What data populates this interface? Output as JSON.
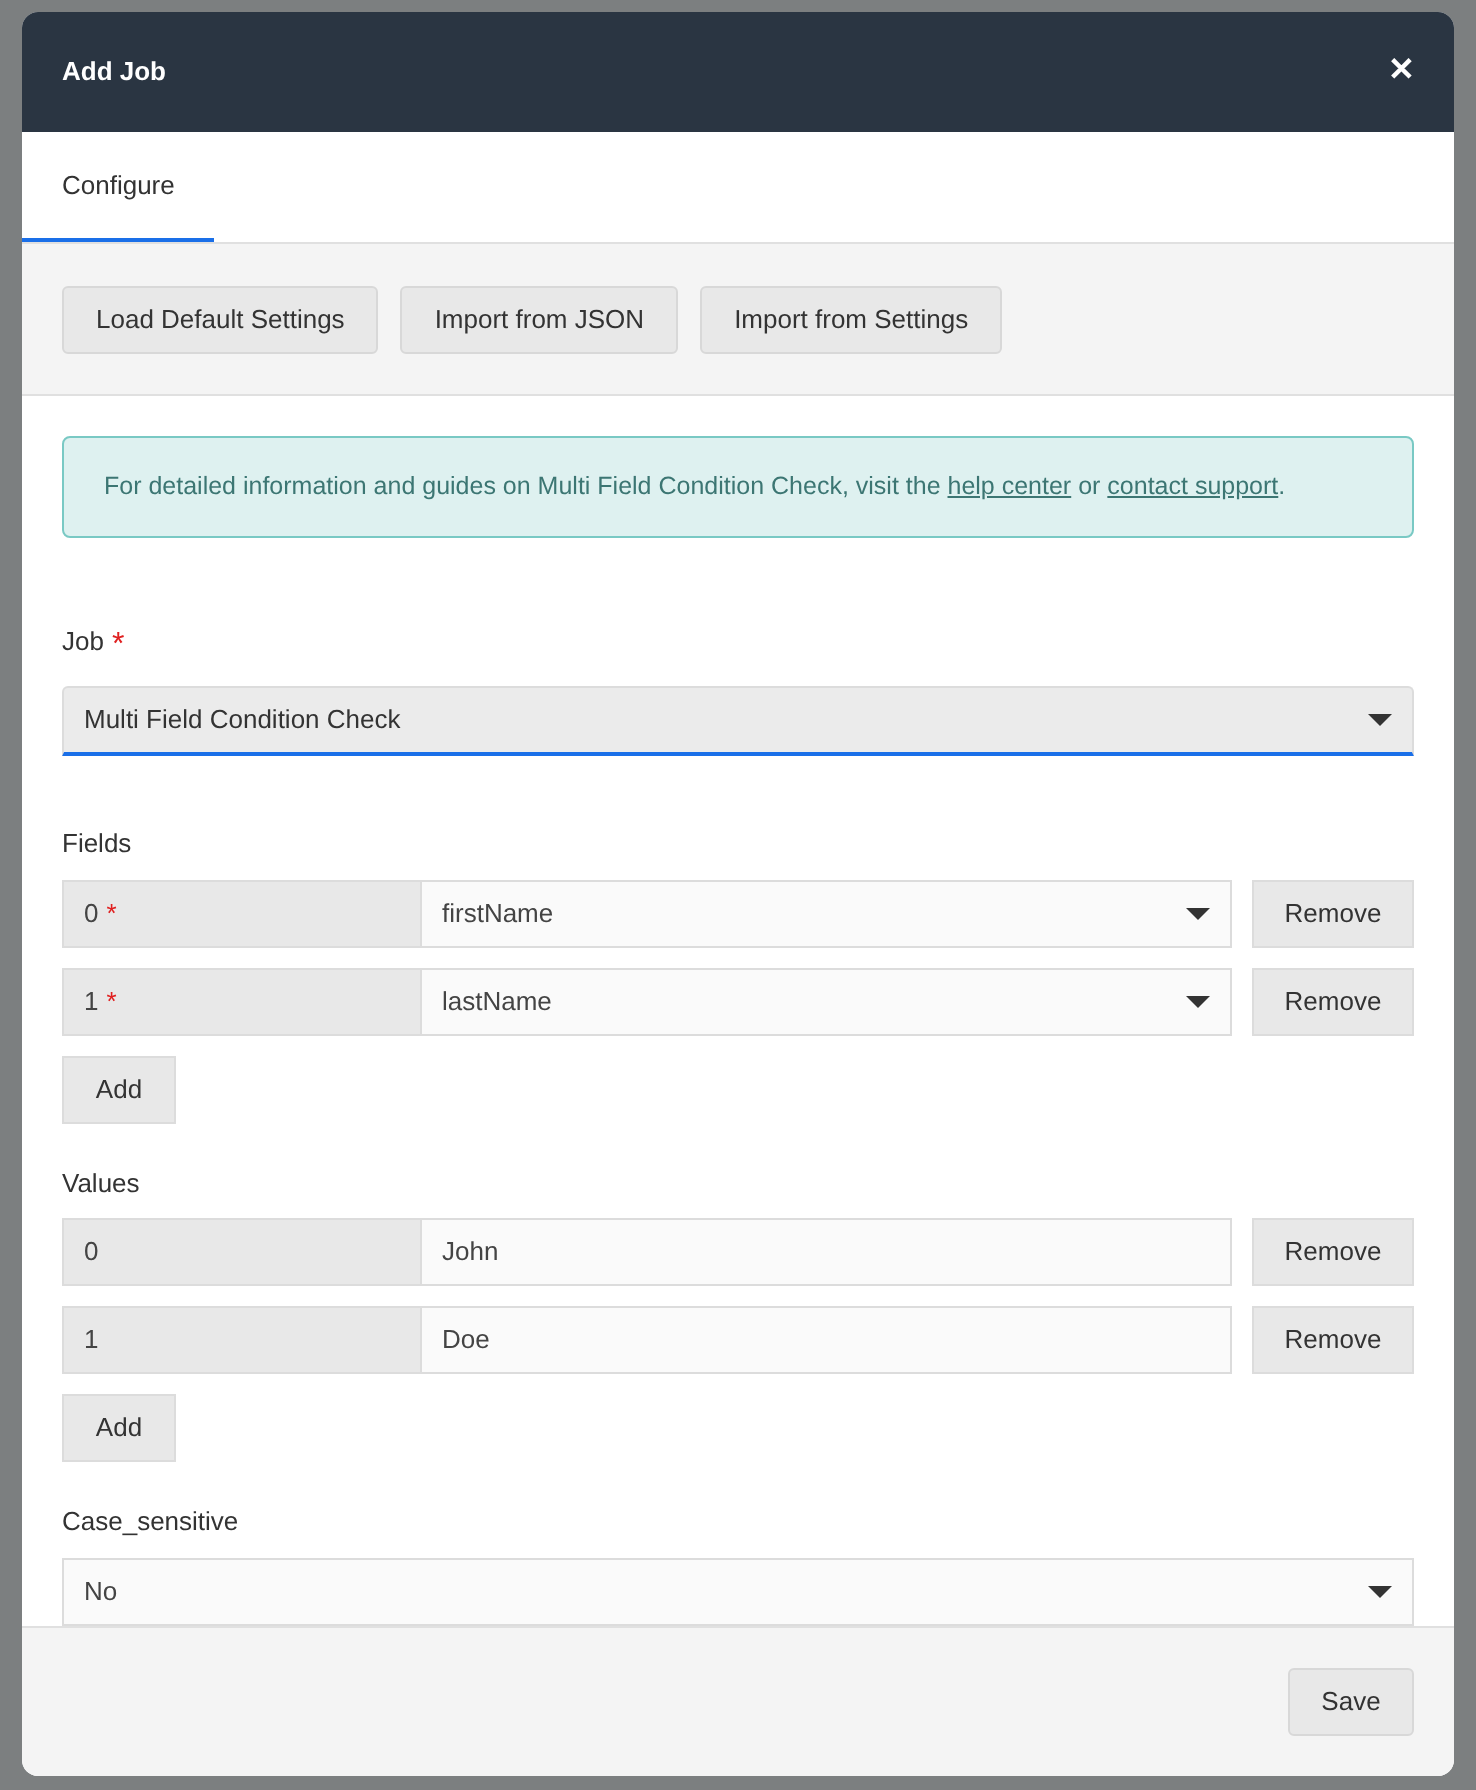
{
  "dialog": {
    "title": "Add Job",
    "close": "✕"
  },
  "tabs": [
    {
      "label": "Configure",
      "selected": true
    }
  ],
  "toolbar": [
    "Load Default Settings",
    "Import from JSON",
    "Import from Settings"
  ],
  "info": {
    "text": "For detailed information and guides on Multi Field Condition Check, visit the ",
    "link1": "help center",
    "middle": " or ",
    "link2": "contact support",
    "end": "."
  },
  "job": {
    "label": "Job",
    "required_mark": "*",
    "value": "Multi Field Condition Check"
  },
  "fields": {
    "label": "Fields",
    "rows": [
      {
        "index": "0",
        "required_mark": "*",
        "value": "firstName",
        "kind": "select",
        "remove": "Remove"
      },
      {
        "index": "1",
        "required_mark": "*",
        "value": "lastName",
        "kind": "select",
        "remove": "Remove"
      }
    ],
    "add": "Add"
  },
  "values": {
    "label": "Values",
    "rows": [
      {
        "index": "0",
        "value": "John",
        "kind": "text",
        "remove": "Remove"
      },
      {
        "index": "1",
        "value": "Doe",
        "kind": "text",
        "remove": "Remove"
      }
    ],
    "add": "Add"
  },
  "case_sensitive": {
    "label": "Case_sensitive",
    "value": "No"
  },
  "footer": {
    "save": "Save"
  }
}
